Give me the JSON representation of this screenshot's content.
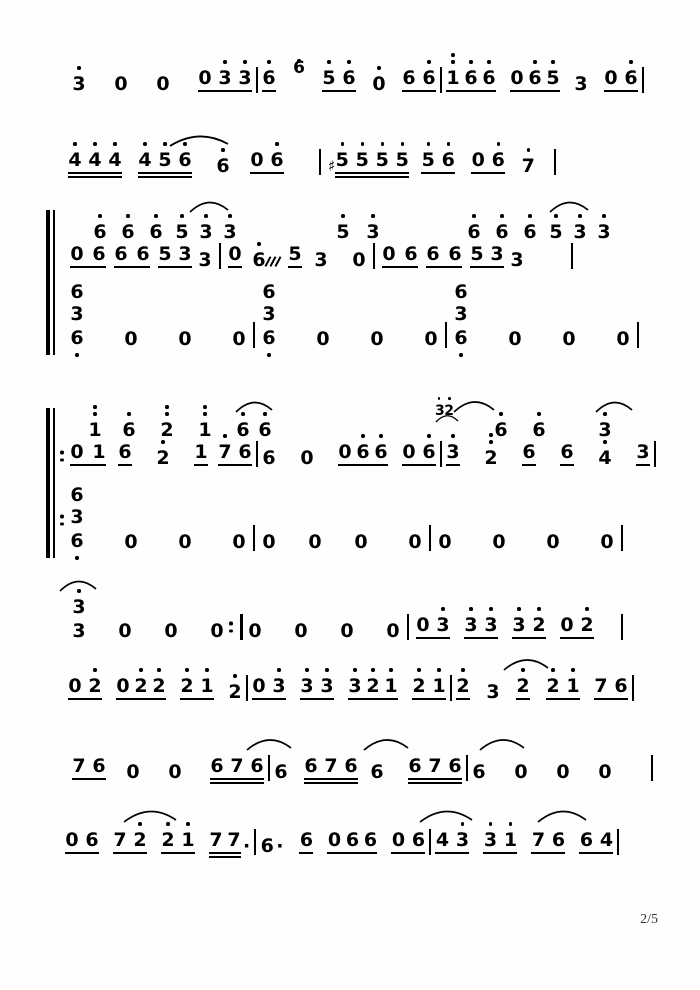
{
  "document": {
    "type": "jianpu-numbered-musical-notation",
    "page_label": "2/5",
    "background_color": "#ffffff",
    "ink_color": "#000000"
  },
  "systems": [
    {
      "id": "system-1",
      "voices": 1,
      "measures": [
        {
          "notes": "3. 0 0 0 3 3",
          "tokens": [
            "3↑",
            "0",
            "0",
            "0",
            "3↑",
            "3↑"
          ]
        },
        {
          "notes": "6↑ 6↑ 6↑ 5↑ 6↑ 0 6↑",
          "tokens": [
            "6↑",
            "6↑",
            "6↑",
            "5↑",
            "6↑",
            "0",
            "6↑"
          ]
        },
        {
          "notes": "1↑↑ 6↑ 6↑ 0 6↑ 5↑ 3 0 6↑",
          "tokens": [
            "1↑↑",
            "6↑",
            "6↑",
            "0",
            "6↑",
            "5↑",
            "3",
            "0",
            "6↑"
          ]
        }
      ]
    },
    {
      "id": "system-2",
      "voices": 1,
      "measures": [
        {
          "tokens": [
            "4↑",
            "4↑",
            "4↑",
            "4↑",
            "5",
            "6↑",
            "6↑",
            "0",
            "6↑"
          ]
        },
        {
          "tokens": [
            "#5↑",
            "5↑",
            "5↑",
            "5↑",
            "5↑",
            "6↑",
            "0",
            "6↑",
            "7↑"
          ]
        }
      ]
    },
    {
      "id": "system-3",
      "voices": 2,
      "upper": [
        {
          "tokens": [
            "0",
            "6↑",
            "6↑",
            "6↑",
            "5↑",
            "3↑",
            "3↑"
          ]
        },
        {
          "tokens": [
            "0",
            "6↑",
            "5↑",
            "3↑",
            "0"
          ]
        },
        {
          "tokens": [
            "0",
            "6↑",
            "6↑",
            "6↑",
            "5↑",
            "3↑",
            "3↑"
          ]
        }
      ],
      "lower_chords": [
        {
          "stack": [
            "6",
            "3",
            "6↓"
          ],
          "rests": [
            "0",
            "0",
            "0"
          ]
        },
        {
          "stack": [
            "6",
            "3",
            "6↓"
          ],
          "rests": [
            "0",
            "0",
            "0"
          ]
        },
        {
          "stack": [
            "6",
            "3",
            "6↓"
          ],
          "rests": [
            "0",
            "0",
            "0"
          ]
        }
      ]
    },
    {
      "id": "system-4",
      "voices": 2,
      "repeat_start": true,
      "upper": [
        {
          "tokens": [
            "0",
            "1↑↑",
            "6↑",
            "2↑↑",
            "1↑↑",
            "7↑",
            "6↑",
            "6↑",
            "0",
            "0",
            "6↑",
            "6↑",
            "0",
            "6↑"
          ]
        },
        {
          "grace": "32",
          "tokens": [
            "3↑",
            "2↑↑",
            "6↑",
            "6↑",
            "4↑",
            "3↑"
          ]
        }
      ],
      "lower_chords": [
        {
          "stack": [
            "6",
            "3",
            "6↓"
          ],
          "rests": [
            "0",
            "0",
            "0"
          ]
        },
        {
          "rests": [
            "0",
            "0",
            "0",
            "0"
          ]
        }
      ]
    },
    {
      "id": "system-5",
      "voices": 1,
      "repeat_end": true,
      "measures": [
        {
          "tokens": [
            "3↑",
            "3",
            "0",
            "0",
            "0"
          ]
        },
        {
          "tokens": [
            "0",
            "0",
            "0",
            "0"
          ]
        },
        {
          "tokens": [
            "0",
            "3↑",
            "3↑",
            "3↑",
            "3↑",
            "2↑",
            "0",
            "2↑"
          ]
        }
      ]
    },
    {
      "id": "system-6",
      "voices": 1,
      "measures": [
        {
          "tokens": [
            "0",
            "2↑",
            "0",
            "2↑",
            "2↑",
            "2↑",
            "1↑",
            "2↑"
          ]
        },
        {
          "tokens": [
            "0",
            "3↑",
            "3",
            "3↑",
            "3↑",
            "2↑",
            "1↑",
            "2↑",
            "1↑"
          ]
        },
        {
          "tokens": [
            "2↑",
            "3",
            "2↑",
            "2↑",
            "1↑",
            "7",
            "6"
          ]
        }
      ]
    },
    {
      "id": "system-7",
      "voices": 1,
      "measures": [
        {
          "tokens": [
            "7",
            "6",
            "0",
            "0",
            "6",
            "7",
            "6"
          ]
        },
        {
          "tokens": [
            "6",
            "6",
            "7",
            "6",
            "6"
          ]
        },
        {
          "tokens": [
            "6",
            "7",
            "6",
            "6",
            "0",
            "0",
            "0"
          ]
        }
      ]
    },
    {
      "id": "system-8",
      "voices": 1,
      "measures": [
        {
          "tokens": [
            "0",
            "6",
            "7",
            "2↑",
            "2↑",
            "1↑",
            "7",
            "7."
          ]
        },
        {
          "tokens": [
            "6.",
            "6",
            "0",
            "6",
            "6",
            "0",
            "6"
          ]
        },
        {
          "tokens": [
            "4",
            "3↑",
            "3↑",
            "1↑",
            "7",
            "6",
            "6",
            "4"
          ]
        }
      ]
    }
  ],
  "glyphs": {
    "sharp": "♯",
    "rest": "0",
    "aug_dot": "·",
    "bar_line": "|",
    "repeat_dots": ":"
  },
  "notes_text": {
    "s1_m1": [
      "3",
      "0",
      "0",
      "0",
      "3",
      "3"
    ],
    "s1_m2": [
      "6",
      "6",
      "6",
      "5",
      "6",
      "0",
      "6"
    ],
    "s1_m3": [
      "1",
      "6",
      "6",
      "0",
      "6",
      "5",
      "3",
      "0",
      "6"
    ],
    "s2_m1": [
      "4",
      "4",
      "4",
      "4",
      "5",
      "6",
      "6",
      "0",
      "6"
    ],
    "s2_m2": [
      "5",
      "5",
      "5",
      "5",
      "5",
      "6",
      "0",
      "6",
      "7"
    ],
    "s3_up": [
      "0",
      "6",
      "6",
      "6",
      "5",
      "3",
      "3"
    ],
    "s3_up2": [
      "0",
      "6",
      "5",
      "3",
      "0"
    ],
    "s3_up3": [
      "0",
      "6",
      "6",
      "6",
      "5",
      "3",
      "3"
    ],
    "s3_chord": [
      "6",
      "3",
      "6"
    ],
    "s4_up": [
      "0",
      "1",
      "6",
      "2",
      "1",
      "7",
      "6",
      "6",
      "0",
      "0",
      "6",
      "6",
      "0",
      "6"
    ],
    "s4_up2": [
      "3",
      "2",
      "6",
      "6",
      "4",
      "3"
    ],
    "s4_grace": "32",
    "s4_chord": [
      "6",
      "3",
      "6"
    ],
    "s5_m1": [
      "3",
      "3",
      "0",
      "0",
      "0"
    ],
    "s5_m2": [
      "0",
      "0",
      "0",
      "0"
    ],
    "s5_m3": [
      "0",
      "3",
      "3",
      "3",
      "3",
      "2",
      "0",
      "2"
    ],
    "s6_m1": [
      "0",
      "2",
      "0",
      "2",
      "2",
      "2",
      "1",
      "2"
    ],
    "s6_m2": [
      "0",
      "3",
      "3",
      "3",
      "3",
      "2",
      "1",
      "2",
      "1"
    ],
    "s6_m3": [
      "2",
      "3",
      "2",
      "2",
      "1",
      "7",
      "6"
    ],
    "s7_m1": [
      "7",
      "6",
      "0",
      "0",
      "6",
      "7",
      "6"
    ],
    "s7_m2": [
      "6",
      "6",
      "7",
      "6",
      "6"
    ],
    "s7_m3": [
      "6",
      "7",
      "6",
      "6",
      "0",
      "0",
      "0"
    ],
    "s8_m1": [
      "0",
      "6",
      "7",
      "2",
      "2",
      "1",
      "7",
      "7"
    ],
    "s8_m2": [
      "6",
      "6",
      "0",
      "6",
      "6",
      "0",
      "6"
    ],
    "s8_m3": [
      "4",
      "3",
      "3",
      "1",
      "7",
      "6",
      "6",
      "4"
    ]
  },
  "footer": {
    "page_number": "2/5"
  }
}
